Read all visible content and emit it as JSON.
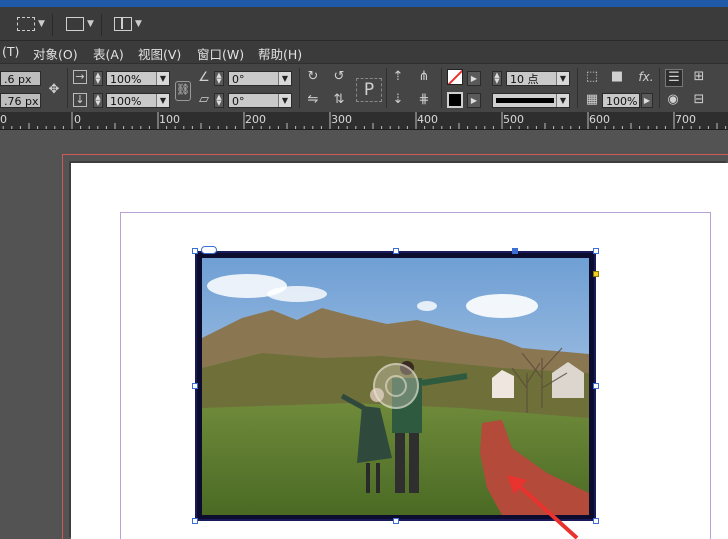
{
  "menubar": {
    "items": [
      "(T)",
      "对象(O)",
      "表(A)",
      "视图(V)",
      "窗口(W)",
      "帮助(H)"
    ]
  },
  "control_panel": {
    "x_value": ".6 px",
    "y_value": ".76 px",
    "scale_x": "100%",
    "scale_y": "100%",
    "rotate_angle": "0°",
    "shear_angle": "0°",
    "stroke_weight": "10 点",
    "opacity": "100%",
    "p_glyph": "P",
    "fx_label": "fx."
  },
  "ruler": {
    "labels": [
      "0",
      "100",
      "200",
      "300",
      "400",
      "500",
      "600",
      "700"
    ]
  },
  "colors": {
    "accent_blue": "#1f5aa8",
    "selection": "#3c6fd6",
    "bleed_guide": "#d05a5a",
    "margin_guide": "#b9a3d6",
    "arrow_red": "#e8332f"
  },
  "icons": {
    "screen-mode": "screen-mode-icon",
    "view-options": "view-options-icon",
    "arrange-docs": "arrange-documents-icon"
  }
}
